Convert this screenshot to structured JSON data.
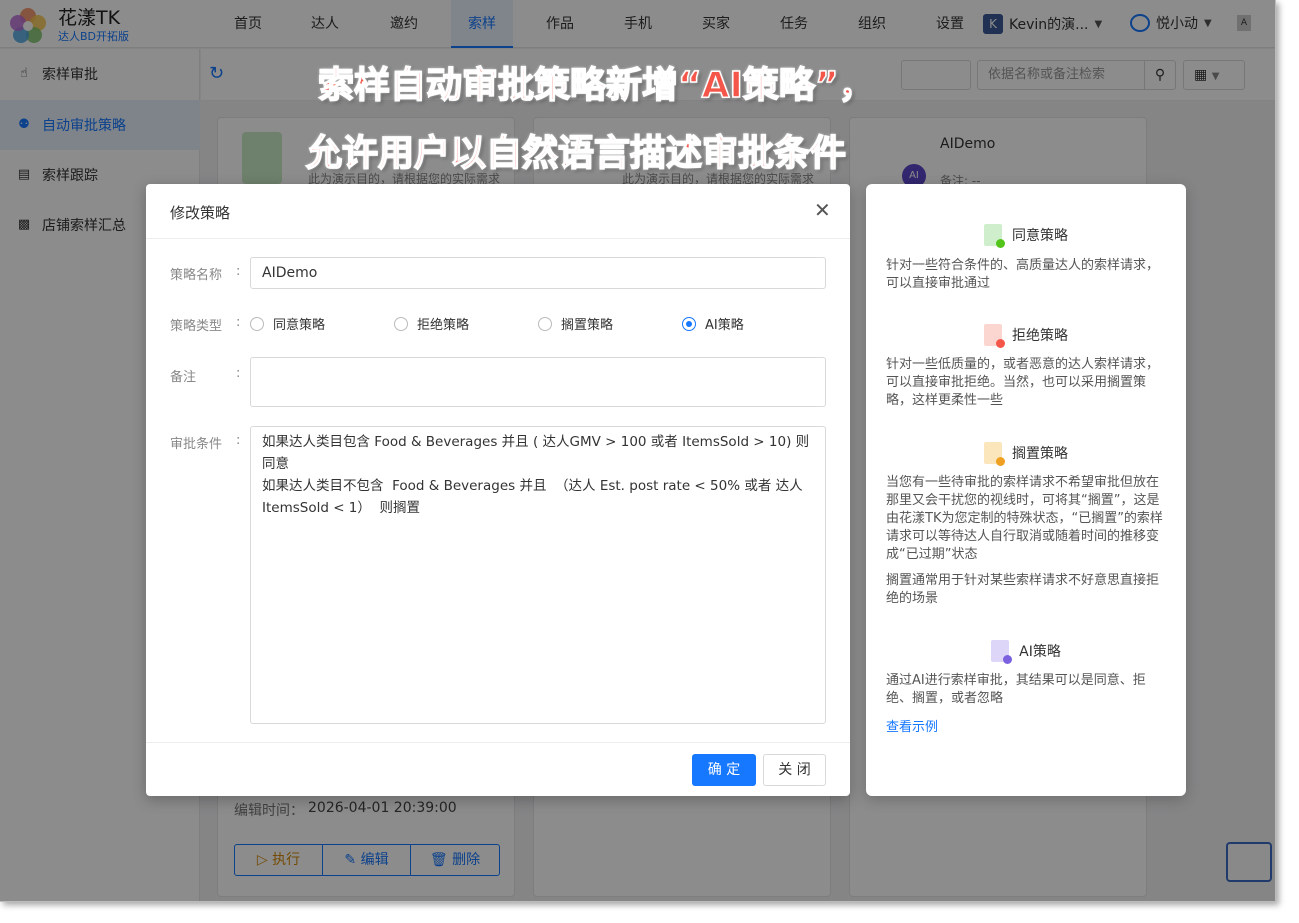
{
  "brand": {
    "name": "花漾TK",
    "subtitle": "达人BD开拓版"
  },
  "nav": [
    "首页",
    "达人",
    "邀约",
    "索样",
    "作品",
    "手机",
    "买家",
    "任务",
    "组织",
    "设置"
  ],
  "nav_active": "索样",
  "user": {
    "initial": "K",
    "name": "Kevin的演...",
    "tenant": "悦小动"
  },
  "sidebar": [
    "索样审批",
    "自动审批策略",
    "索样跟踪",
    "店铺索样汇总"
  ],
  "sidebar_active": "自动审批策略",
  "toolbar": {
    "search_placeholder": "依据名称或备注检索"
  },
  "bg_cards": {
    "desc_left": "此为演示目的，请根据您的实际需求",
    "desc_mid": "此为演示目的，请根据您的实际需求",
    "right_title": "AIDemo",
    "right_note": "备注: --",
    "edit_time_label": "编辑时间：",
    "edit_time": "2026-04-01 20:39:00",
    "actions": [
      "执行",
      "编辑",
      "删除"
    ]
  },
  "banner": {
    "line1": "索样自动审批策略新增“AI策略”，",
    "line2": "允许用户以自然语言描述审批条件"
  },
  "dialog": {
    "title": "修改策略",
    "name_label": "策略名称",
    "name_value": "AIDemo",
    "type_label": "策略类型",
    "type_options": [
      "同意策略",
      "拒绝策略",
      "搁置策略",
      "AI策略"
    ],
    "type_selected": "AI策略",
    "remark_label": "备注",
    "remark_value": "",
    "cond_label": "审批条件",
    "cond_lines": [
      "如果达人类目包含 Food & Beverages 并且 ( 达人GMV > 100 或者 ItemsSold > 10) 则同意",
      "如果达人类目不包含  Food & Beverages 并且  （达人 Est. post rate < 50% 或者 达人 ItemsSold < 1）  则搁置"
    ],
    "ok": "确 定",
    "close": "关 闭"
  },
  "help": {
    "sections": [
      {
        "title": "同意策略",
        "color": "g",
        "paras": [
          "针对一些符合条件的、高质量达人的索样请求，可以直接审批通过"
        ]
      },
      {
        "title": "拒绝策略",
        "color": "r",
        "paras": [
          "针对一些低质量的，或者恶意的达人索样请求，可以直接审批拒绝。当然，也可以采用搁置策略，这样更柔性一些"
        ]
      },
      {
        "title": "搁置策略",
        "color": "y",
        "paras": [
          "当您有一些待审批的索样请求不希望审批但放在那里又会干扰您的视线时，可将其“搁置”，这是由花漾TK为您定制的特殊状态，“已搁置”的索样请求可以等待达人自行取消或随着时间的推移变成“已过期”状态",
          "搁置通常用于针对某些索样请求不好意思直接拒绝的场景"
        ]
      },
      {
        "title": "AI策略",
        "color": "p",
        "paras": [
          "通过AI进行索样审批，其结果可以是同意、拒绝、搁置，或者忽略"
        ]
      }
    ],
    "link": "查看示例"
  }
}
